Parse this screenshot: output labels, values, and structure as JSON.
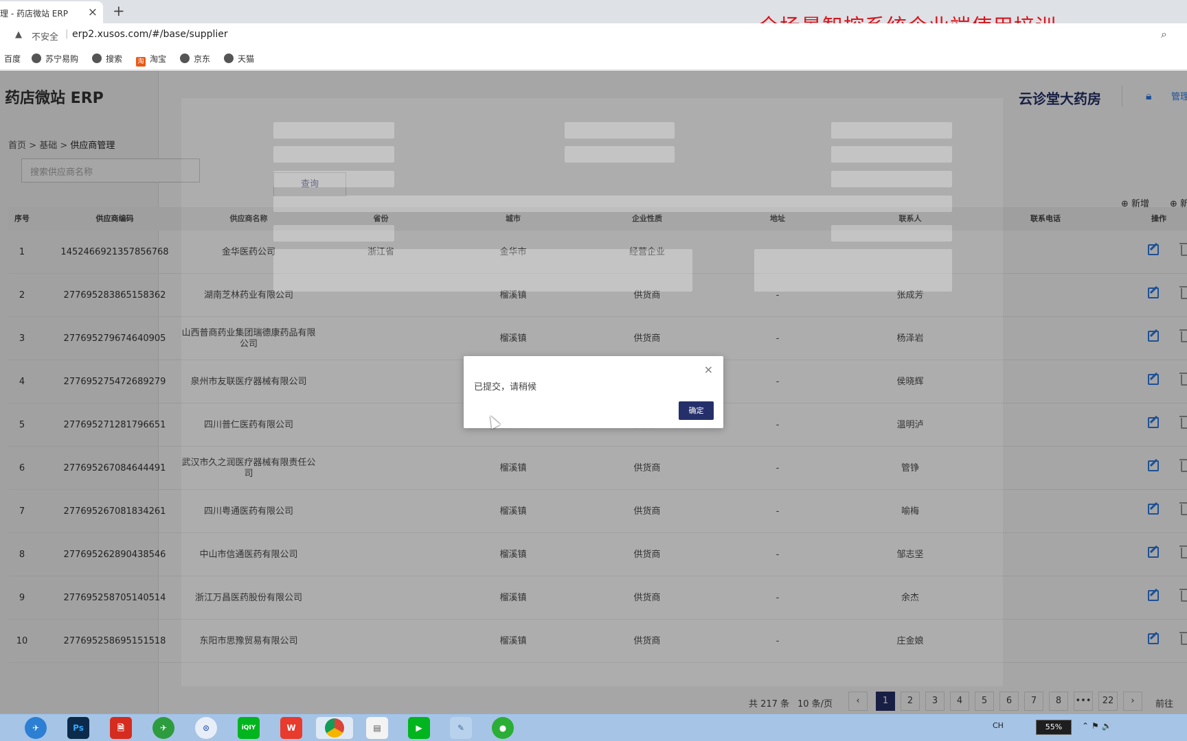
{
  "browser": {
    "tab_title": "理 - 药店微站 ERP",
    "tab_close": "×",
    "new_tab": "+",
    "insecure_label": "不安全",
    "url": "erp2.xusos.com/#/base/supplier",
    "bookmarks": [
      "百度",
      "苏宁易购",
      "搜索",
      "淘宝",
      "京东",
      "天猫"
    ]
  },
  "banner": "全场景智控系统企业端使用培训",
  "header": {
    "logo": "药店微站 ERP",
    "store_name": "云诊堂大药房",
    "manage": "管理"
  },
  "breadcrumb": {
    "home": "首页",
    "base": "基础",
    "current": "供应商管理",
    "sep": ">"
  },
  "search": {
    "placeholder": "搜索供应商名称",
    "query_button": "查询"
  },
  "actions": {
    "add": "⊕ 新增",
    "add2": "⊕ 新"
  },
  "table": {
    "columns": [
      "序号",
      "供应商编码",
      "供应商名称",
      "省份",
      "城市",
      "企业性质",
      "地址",
      "联系人",
      "联系电话",
      "操作"
    ],
    "rows": [
      {
        "no": "1",
        "code": "1452466921357856768",
        "name": "金华医药公司",
        "province": "浙江省",
        "city": "金华市",
        "type": "经营企业",
        "address": "",
        "contact": ""
      },
      {
        "no": "2",
        "code": "277695283865158362",
        "name": "湖南芝林药业有限公司",
        "province": "",
        "city": "榴溪镇",
        "type": "供货商",
        "address": "-",
        "contact": "张成芳"
      },
      {
        "no": "3",
        "code": "277695279674640905",
        "name": "山西普商药业集团瑞德康药品有限公司",
        "province": "",
        "city": "榴溪镇",
        "type": "供货商",
        "address": "-",
        "contact": "杨泽岩"
      },
      {
        "no": "4",
        "code": "277695275472689279",
        "name": "泉州市友联医疗器械有限公司",
        "province": "",
        "city": "榴溪镇",
        "type": "供货商",
        "address": "-",
        "contact": "侯晓辉"
      },
      {
        "no": "5",
        "code": "277695271281796651",
        "name": "四川普仁医药有限公司",
        "province": "",
        "city": "榴溪镇",
        "type": "供货商",
        "address": "-",
        "contact": "温明泸"
      },
      {
        "no": "6",
        "code": "277695267084644491",
        "name": "武汉市久之润医疗器械有限责任公司",
        "province": "",
        "city": "榴溪镇",
        "type": "供货商",
        "address": "-",
        "contact": "管铮"
      },
      {
        "no": "7",
        "code": "277695267081834261",
        "name": "四川粤通医药有限公司",
        "province": "",
        "city": "榴溪镇",
        "type": "供货商",
        "address": "-",
        "contact": "喻梅"
      },
      {
        "no": "8",
        "code": "277695262890438546",
        "name": "中山市信通医药有限公司",
        "province": "",
        "city": "榴溪镇",
        "type": "供货商",
        "address": "-",
        "contact": "邹志坚"
      },
      {
        "no": "9",
        "code": "277695258705140514",
        "name": "浙江万昌医药股份有限公司",
        "province": "",
        "city": "榴溪镇",
        "type": "供货商",
        "address": "-",
        "contact": "余杰"
      },
      {
        "no": "10",
        "code": "277695258695151518",
        "name": "东阳市思豫贸易有限公司",
        "province": "",
        "city": "榴溪镇",
        "type": "供货商",
        "address": "-",
        "contact": "庄金娘"
      }
    ]
  },
  "pagination": {
    "total": "共 217 条",
    "page_size": "10 条/页",
    "prev": "‹",
    "pages": [
      "1",
      "2",
      "3",
      "4",
      "5",
      "6",
      "7",
      "8",
      "•••",
      "22"
    ],
    "current": "1",
    "next": "›",
    "goto": "前往"
  },
  "dialog": {
    "message": "已提交，请稍候",
    "ok_button": "确定",
    "close": "×"
  },
  "taskbar": {
    "apps": [
      "Ps",
      "🗎",
      "⊙",
      "iQIY",
      "W"
    ],
    "tray_lang": "CH",
    "battery": "55%"
  },
  "colors": {
    "primary": "#25306b",
    "link": "#2d7be5",
    "banner": "#d8161b"
  }
}
